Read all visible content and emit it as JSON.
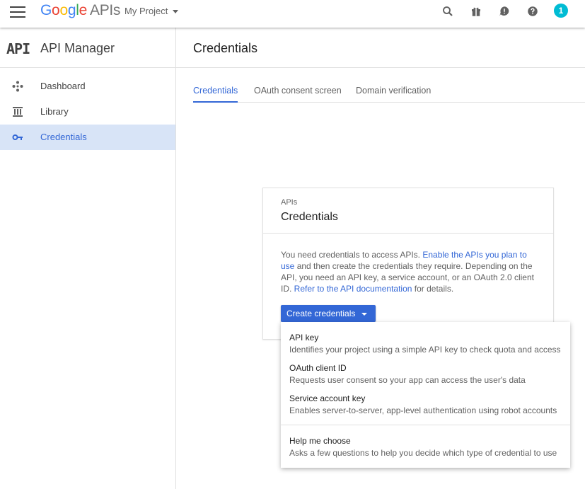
{
  "topbar": {
    "logo_parts": [
      {
        "text": "G",
        "color": "#4285f4"
      },
      {
        "text": "o",
        "color": "#ea4335"
      },
      {
        "text": "o",
        "color": "#fbbc05"
      },
      {
        "text": "g",
        "color": "#4285f4"
      },
      {
        "text": "l",
        "color": "#34a853"
      },
      {
        "text": "e",
        "color": "#ea4335"
      }
    ],
    "logo_suffix": "APIs",
    "project_name": "My Project",
    "notification_count": "1",
    "icons": [
      "search-icon",
      "gift-icon",
      "feedback-icon",
      "help-icon"
    ]
  },
  "sidebar": {
    "logo_text": "API",
    "title": "API Manager",
    "items": [
      {
        "label": "Dashboard",
        "icon": "dashboard-icon",
        "active": false
      },
      {
        "label": "Library",
        "icon": "library-icon",
        "active": false
      },
      {
        "label": "Credentials",
        "icon": "key-icon",
        "active": true
      }
    ]
  },
  "main": {
    "title": "Credentials",
    "tabs": [
      {
        "label": "Credentials",
        "active": true
      },
      {
        "label": "OAuth consent screen",
        "active": false
      },
      {
        "label": "Domain verification",
        "active": false
      }
    ]
  },
  "card": {
    "subtitle": "APIs",
    "title": "Credentials",
    "text_1": "You need credentials to access APIs. ",
    "link_1": "Enable the APIs you plan to use",
    "text_2": " and then create the credentials they require. Depending on the API, you need an API key, a service account, or an OAuth 2.0 client ID. ",
    "link_2": "Refer to the API documentation",
    "text_3": " for details.",
    "button_label": "Create credentials"
  },
  "menu": {
    "items": [
      {
        "title": "API key",
        "description": "Identifies your project using a simple API key to check quota and access"
      },
      {
        "title": "OAuth client ID",
        "description": "Requests user consent so your app can access the user's data"
      },
      {
        "title": "Service account key",
        "description": "Enables server-to-server, app-level authentication using robot accounts"
      },
      {
        "title": "Help me choose",
        "description": "Asks a few questions to help you decide which type of credential to use"
      }
    ]
  },
  "colors": {
    "accent": "#3367d6",
    "active_nav_bg": "#d8e4f7",
    "badge": "#00bcd4"
  }
}
